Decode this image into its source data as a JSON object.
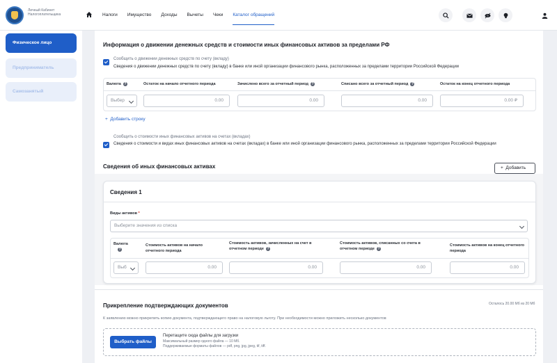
{
  "header": {
    "brand": "Личный Кабинет Налогоплательщика",
    "nav": [
      "Налоги",
      "Имущество",
      "Доходы",
      "Вычеты",
      "Чеки",
      "Каталог обращений"
    ],
    "active_nav": 5
  },
  "sidebar": {
    "items": [
      "Физическое лицо",
      "Предприниматель",
      "Самозанятый"
    ]
  },
  "section1": {
    "title": "Информация о движении денежных средств и стоимости иных финансовых активов за пределами РФ",
    "cb1_title": "Сообщить о движении денежных средств по счету (вкладу)",
    "cb1_desc": "Сведения о движении денежных средств по счету (вкладу) в банке или иной организации финансового рынка, расположенных за пределами территории Российской Федерации",
    "table": {
      "headers": [
        "Валюта",
        "Остаток на начало отчетного периода",
        "Зачислено всего за отчетный период",
        "Списано всего за отчетный период",
        "Остаток на конец отчетного периода"
      ],
      "select_value": "Выбер",
      "values": [
        "0.00",
        "0.00",
        "0.00",
        "0.00"
      ],
      "currency": "₽"
    },
    "add_row": "Добавить строку",
    "cb2_title": "Сообщить о стоимости иных финансовых активов на счетах (вкладах)",
    "cb2_desc": "Сведения о стоимости и видах иных финансовых активов на счетах (вкладах) в банке или иной организации финансового рынка, расположенных за пределами территории Российской Федерации"
  },
  "section2": {
    "title": "Сведения об иных финансовых активах",
    "add_button": "Добавить",
    "card_title": "Сведения 1",
    "asset_label": "Виды активов",
    "asset_required": "*",
    "asset_placeholder": "Выберите значения из списка",
    "table": {
      "headers": [
        "Валюта",
        "Стоимость активов на начало отчетного периода",
        "Стоимость активов, зачисленных на счет в отчетном периоде",
        "Стоимость активов, списанных со счета в отчетном периоде",
        "Стоимость активов на конец отчетного периода"
      ],
      "select_value": "Выб",
      "values": [
        "0.00",
        "0.00",
        "0.00",
        "0.00"
      ]
    }
  },
  "section3": {
    "title": "Прикрепление подтверждающих документов",
    "remaining": "Осталось 20.00 Мб из 20 Мб",
    "desc": "К заявлению можно прикрепить копию документа, подтверждающего право на налоговую льготу. При необходимости можно приложить несколько документов",
    "button": "Выбрать файлы",
    "drop_text": "Перетащите сюда файлы для загрузки",
    "max_size": "Максимальный размер одного файла — 10 Мб.",
    "formats": "Поддерживаемые форматы файлов — pdf, png, jpg, jpeg, tif, tiff."
  }
}
